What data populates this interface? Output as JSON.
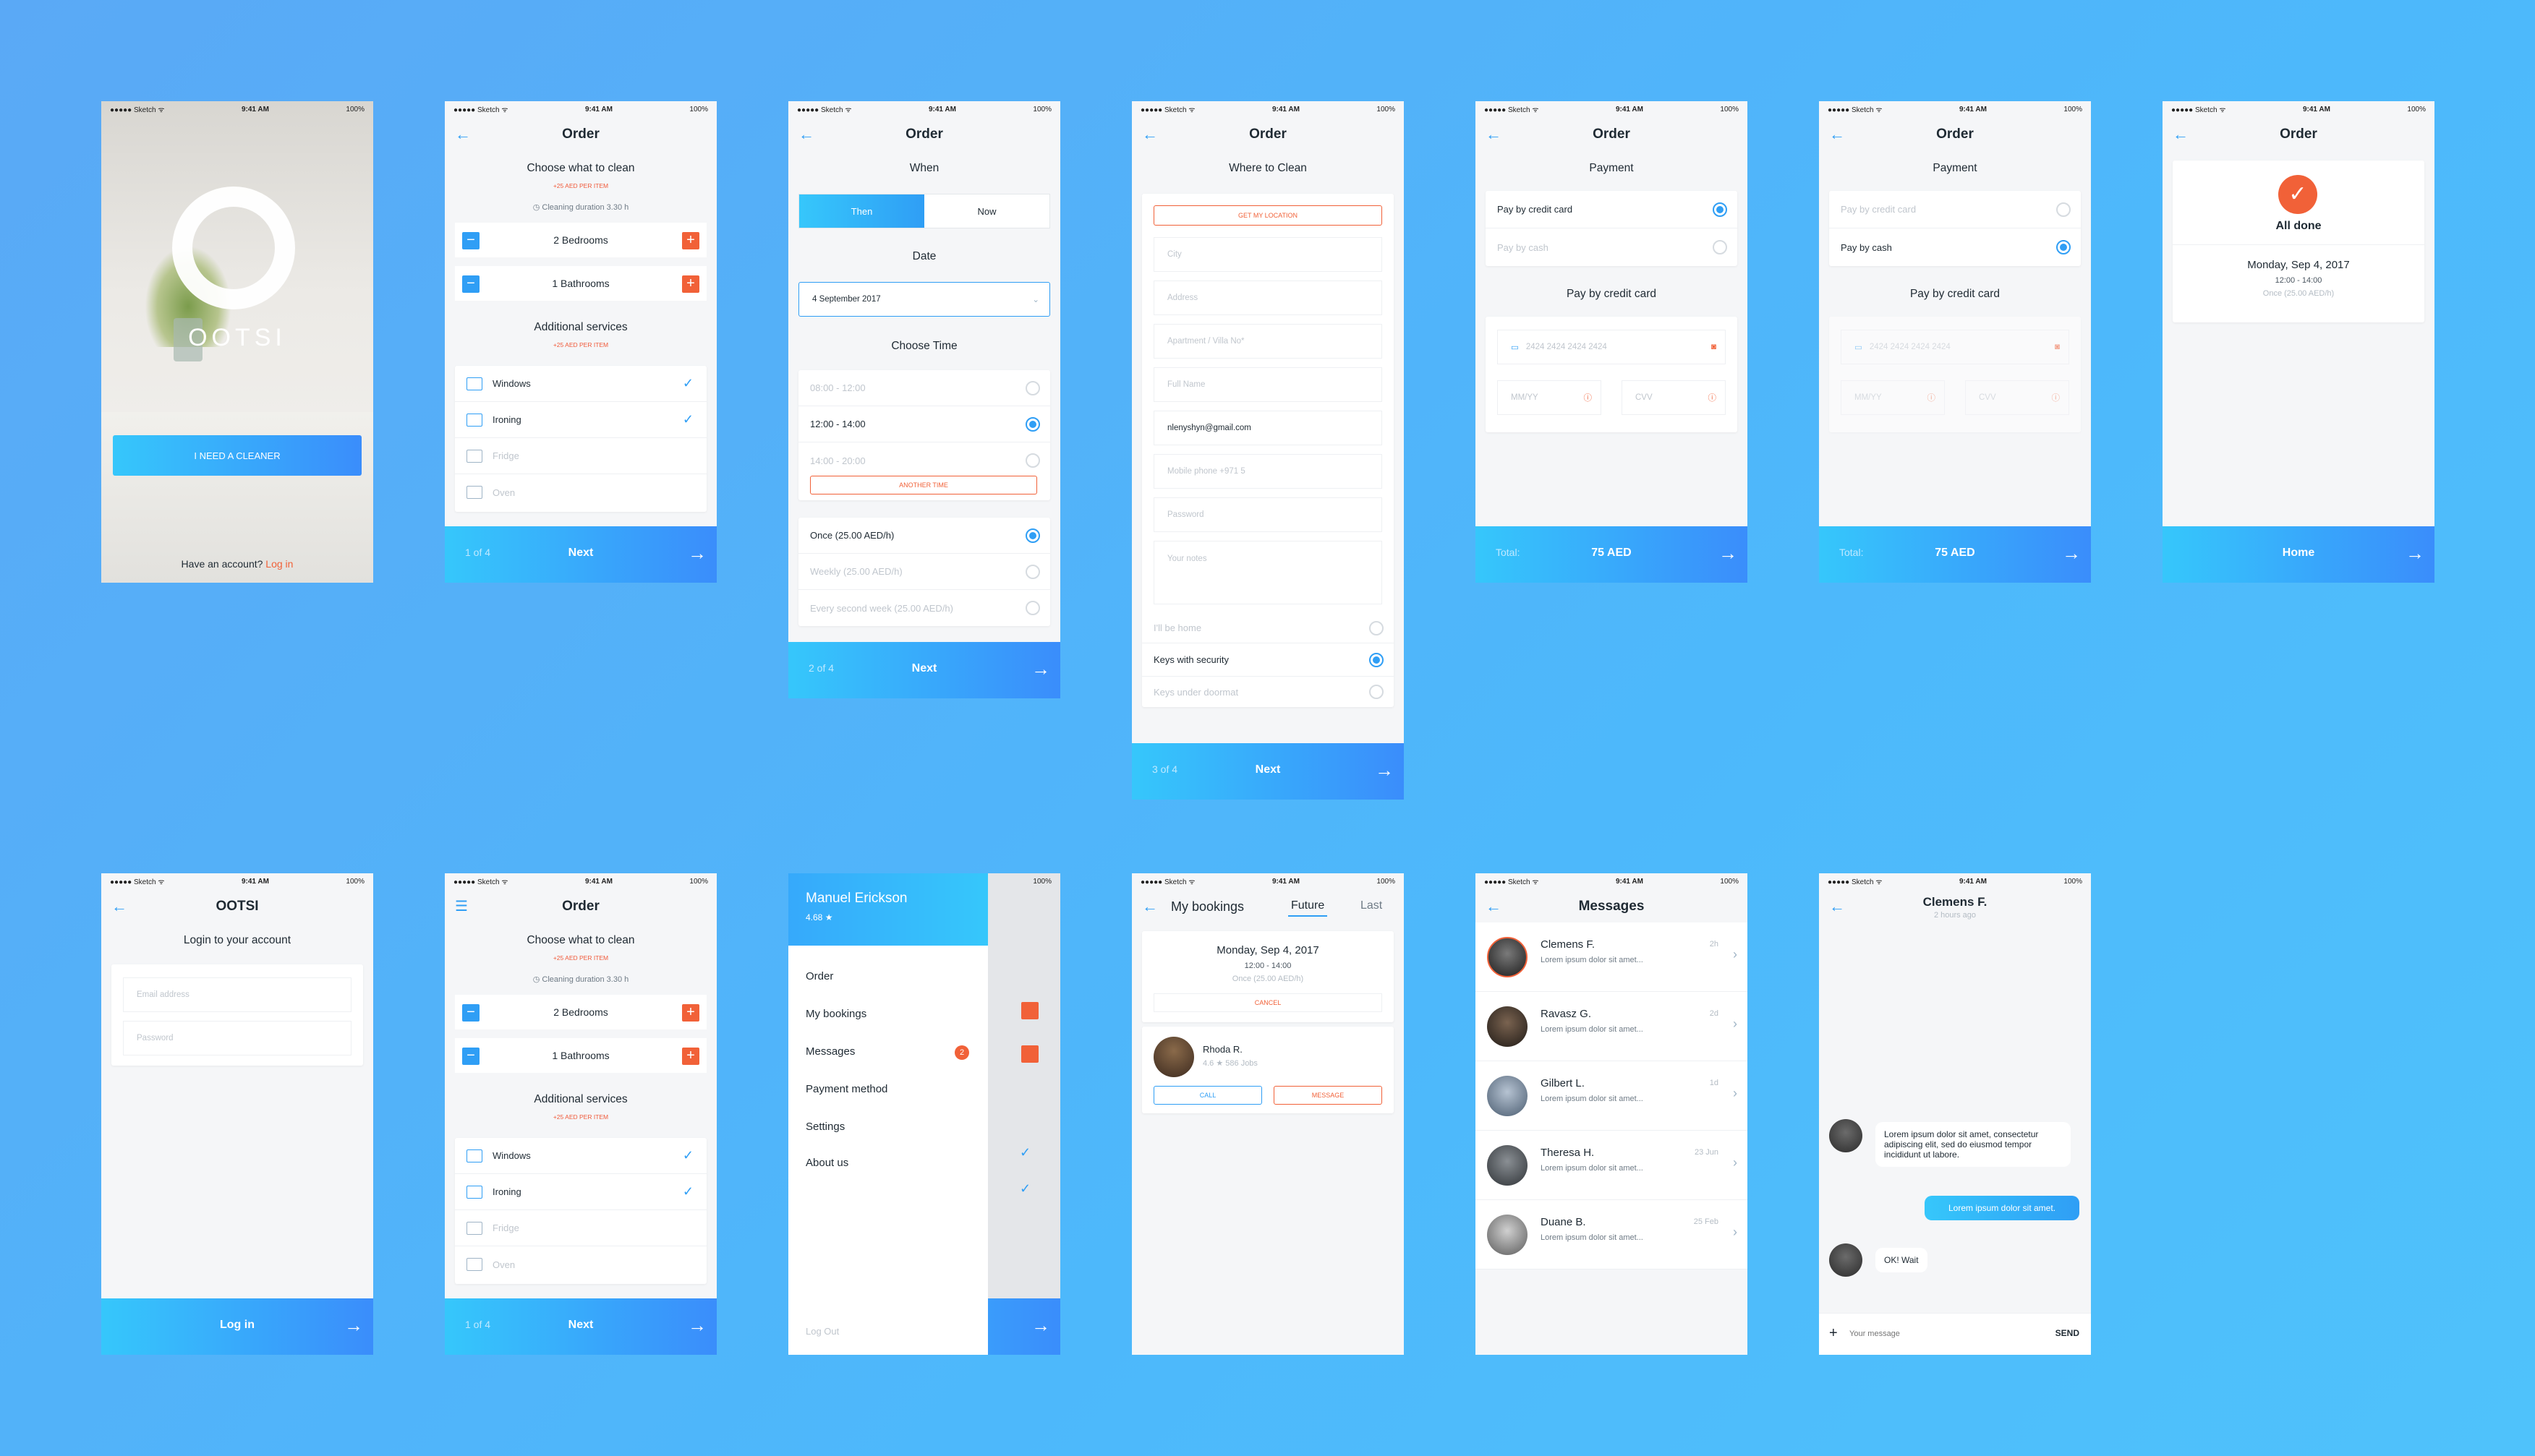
{
  "status": {
    "carrier": "●●●●● Sketch ᯤ",
    "time": "9:41 AM",
    "battery": "100%"
  },
  "s1": {
    "logo": "OOTSI",
    "cta": "I NEED A CLEANER",
    "have": "Have an account?",
    "login": "Log in"
  },
  "order": {
    "title": "Order",
    "choose": "Choose what to clean",
    "per_item": "+25 AED PER ITEM",
    "duration": "Cleaning duration 3.30 h",
    "rooms": [
      {
        "label": "2 Bedrooms"
      },
      {
        "label": "1 Bathrooms"
      }
    ],
    "additional": "Additional services",
    "services": [
      {
        "label": "Windows",
        "checked": true
      },
      {
        "label": "Ironing",
        "checked": true
      },
      {
        "label": "Fridge",
        "checked": false
      },
      {
        "label": "Oven",
        "checked": false
      }
    ],
    "step": "1 of 4",
    "next": "Next"
  },
  "when": {
    "title": "Order",
    "when": "When",
    "tabs": [
      "Then",
      "Now"
    ],
    "date_label": "Date",
    "date": "4 September 2017",
    "choose_time": "Choose Time",
    "times": [
      "08:00 - 12:00",
      "12:00 - 14:00",
      "14:00 - 20:00"
    ],
    "another": "ANOTHER TIME",
    "freq": [
      "Once (25.00 AED/h)",
      "Weekly (25.00 AED/h)",
      "Every second week (25.00 AED/h)"
    ],
    "step": "2 of 4",
    "next": "Next"
  },
  "where": {
    "title": "Order",
    "heading": "Where to Clean",
    "location": "GET MY LOCATION",
    "fields": [
      "City",
      "Address",
      "Apartment / Villa No*",
      "Full Name",
      "nlenyshyn@gmail.com",
      "Mobile phone +971 5",
      "Password",
      "Your notes"
    ],
    "access": [
      "I'll be home",
      "Keys with security",
      "Keys under doormat"
    ],
    "step": "3 of 4",
    "next": "Next"
  },
  "pay1": {
    "title": "Order",
    "payment": "Payment",
    "options": [
      "Pay by credit card",
      "Pay by cash"
    ],
    "method": "Pay by credit card",
    "card": "2424 2424 2424 2424",
    "mm": "MM/YY",
    "cvv": "CVV",
    "total": "Total:",
    "amount": "75 AED"
  },
  "pay2": {
    "title": "Order",
    "payment": "Payment",
    "options": [
      "Pay by credit card",
      "Pay by cash"
    ],
    "method": "Pay by credit card",
    "card": "2424 2424 2424 2424",
    "mm": "MM/YY",
    "cvv": "CVV",
    "total": "Total:",
    "amount": "75 AED"
  },
  "done": {
    "title": "Order",
    "done": "All done",
    "date": "Monday, Sep 4, 2017",
    "time": "12:00 - 14:00",
    "freq": "Once (25.00 AED/h)",
    "home": "Home"
  },
  "login": {
    "title": "OOTSI",
    "heading": "Login to your account",
    "email": "Email address",
    "password": "Password",
    "btn": "Log in"
  },
  "menu": {
    "name": "Manuel Erickson",
    "rating": "4.68 ★",
    "items": [
      "Order",
      "My bookings",
      "Messages",
      "Payment method",
      "Settings",
      "About us"
    ],
    "badge": "2",
    "logout": "Log Out"
  },
  "bookings": {
    "title": "My bookings",
    "tabs": [
      "Future",
      "Last"
    ],
    "date": "Monday, Sep 4, 2017",
    "time": "12:00 - 14:00",
    "freq": "Once (25.00 AED/h)",
    "cancel": "CANCEL",
    "cleaner": "Rhoda R.",
    "rating": "4.6 ★",
    "jobs": "586 Jobs",
    "call": "CALL",
    "message": "MESSAGE"
  },
  "messages": {
    "title": "Messages",
    "items": [
      {
        "name": "Clemens F.",
        "text": "Lorem ipsum dolor sit amet...",
        "date": "2h"
      },
      {
        "name": "Ravasz G.",
        "text": "Lorem ipsum dolor sit amet...",
        "date": "2d"
      },
      {
        "name": "Gilbert L.",
        "text": "Lorem ipsum dolor sit amet...",
        "date": "1d"
      },
      {
        "name": "Theresa H.",
        "text": "Lorem ipsum dolor sit amet...",
        "date": "23 Jun"
      },
      {
        "name": "Duane B.",
        "text": "Lorem ipsum dolor sit amet...",
        "date": "25 Feb"
      }
    ]
  },
  "chat": {
    "name": "Clemens F.",
    "ago": "2 hours ago",
    "m1": "Lorem ipsum dolor sit amet, consectetur adipiscing elit, sed do eiusmod tempor incididunt ut labore.",
    "m2": "Lorem ipsum dolor sit amet.",
    "m3": "OK! Wait",
    "placeholder": "Your message",
    "send": "SEND"
  },
  "colors": {
    "accent": "#2f9ef5",
    "orange": "#f16138",
    "bg": "#4db8fb"
  }
}
